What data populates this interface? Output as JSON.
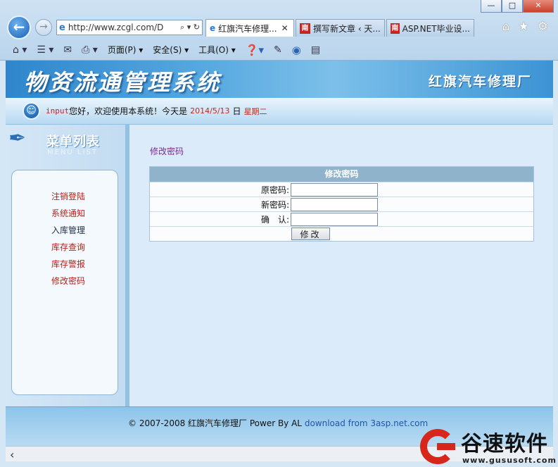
{
  "browser": {
    "address_url": "http://www.zcgl.com/D",
    "address_tools": "⌕ ▾ ↻",
    "tabs": [
      {
        "label": "红旗汽车修理...",
        "icon": "ie-icon",
        "active": true
      },
      {
        "label": "撰写新文章 ‹ 天...",
        "icon": "nan-icon"
      },
      {
        "label": "ASP.NET毕业设...",
        "icon": "nan-icon"
      }
    ],
    "favicon_nan": "南",
    "toolbar": {
      "page": "页面(P)",
      "safety": "安全(S)",
      "tools": "工具(O)"
    }
  },
  "header": {
    "system_title": "物资流通管理系统",
    "factory_name": "红旗汽车修理厂"
  },
  "welcome": {
    "user": "input",
    "greeting": "您好，欢迎使用本系统！今天是",
    "date": "2014/5/13",
    "day_label": "日",
    "weekday": "星期二"
  },
  "menu": {
    "title": "菜单列表",
    "subtitle": "MENU LIST",
    "items": [
      {
        "label": "注销登陆",
        "style": "red"
      },
      {
        "label": "系统通知",
        "style": "red"
      },
      {
        "label": "入库管理",
        "style": "dark"
      },
      {
        "label": "库存查询",
        "style": "red"
      },
      {
        "label": "库存警报",
        "style": "red"
      },
      {
        "label": "修改密码",
        "style": "red"
      }
    ]
  },
  "main": {
    "breadcrumb": "修改密码",
    "form": {
      "header": "修改密码",
      "old_password_label": "原密码:",
      "new_password_label": "新密码:",
      "confirm_label": "确　认:",
      "submit_label": "修改"
    }
  },
  "footer": {
    "text": "© 2007-2008 红旗汽车修理厂 Power By AL",
    "link": "download from 3asp.net.com"
  },
  "watermark": {
    "brand": "谷速软件",
    "url": "www.gususoft.com"
  }
}
